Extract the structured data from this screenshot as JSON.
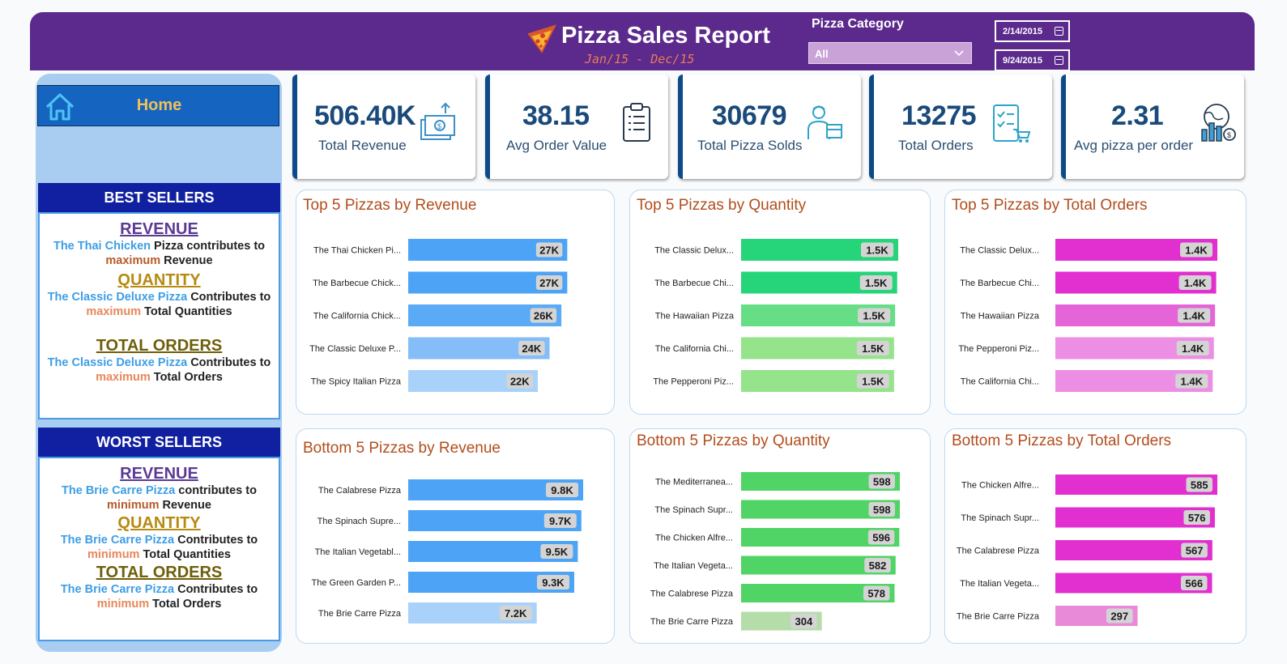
{
  "header": {
    "title": "Pizza Sales Report",
    "subtitle": "Jan/15 - Dec/15",
    "category_label": "Pizza Category",
    "category_value": "All",
    "start_date": "2/14/2015",
    "end_date": "9/24/2015",
    "color": "#5c2a8c"
  },
  "sidebar": {
    "home_label": "Home",
    "best": {
      "heading": "BEST SELLERS",
      "revenue_title": "REVENUE",
      "revenue_pizza": "The Thai Chicken",
      "revenue_mid": " Pizza contributes to",
      "revenue_word": "maximum",
      "revenue_tail": " Revenue",
      "quantity_title": "QUANTITY",
      "quantity_pizza": "The Classic Deluxe Pizza",
      "quantity_mid": " Contributes to ",
      "quantity_word": "maximum",
      "quantity_tail": " Total Quantities",
      "orders_title": "TOTAL ORDERS",
      "orders_pizza": "The Classic Deluxe Pizza",
      "orders_mid": " Contributes to ",
      "orders_word": "maximum",
      "orders_tail": " Total Orders"
    },
    "worst": {
      "heading": "WORST SELLERS",
      "revenue_title": "REVENUE",
      "revenue_pizza": "The Brie Carre Pizza",
      "revenue_mid": " contributes to",
      "revenue_word": "minimum",
      "revenue_tail": " Revenue",
      "quantity_title": "QUANTITY",
      "quantity_pizza": "The Brie Carre Pizza",
      "quantity_mid": " Contributes to ",
      "quantity_word": "minimum",
      "quantity_tail": " Total Quantities",
      "orders_title": "TOTAL ORDERS",
      "orders_pizza": "The Brie Carre Pizza",
      "orders_mid": " Contributes to ",
      "orders_word": "minimum",
      "orders_tail": " Total Orders"
    }
  },
  "kpis": [
    {
      "value": "506.40K",
      "label": "Total Revenue",
      "icon": "money-icon"
    },
    {
      "value": "38.15",
      "label": "Avg Order Value",
      "icon": "clipboard-icon"
    },
    {
      "value": "30679",
      "label": "Total Pizza Solds",
      "icon": "delivery-person-icon"
    },
    {
      "value": "13275",
      "label": "Total Orders",
      "icon": "order-checklist-icon"
    },
    {
      "value": "2.31",
      "label": "Avg pizza per order",
      "icon": "global-chart-icon"
    }
  ],
  "chart_data": [
    {
      "type": "bar",
      "title": "Top 5 Pizzas by Revenue",
      "categories": [
        "The Thai Chicken Pi...",
        "The Barbecue Chick...",
        "The California Chick...",
        "The Classic Deluxe P...",
        "The Spicy Italian Pizza"
      ],
      "values": [
        27000,
        27000,
        26000,
        24000,
        22000
      ],
      "labels": [
        "27K",
        "27K",
        "26K",
        "24K",
        "22K"
      ],
      "colors": [
        "#4da3f5",
        "#4da3f5",
        "#5baaf5",
        "#84bdf7",
        "#a8d2fa"
      ],
      "max": 27500
    },
    {
      "type": "bar",
      "title": "Top 5 Pizzas by Quantity",
      "categories": [
        "The Classic Delux...",
        "The Barbecue Chi...",
        "The Hawaiian Pizza",
        "The California Chi...",
        "The Pepperoni Piz..."
      ],
      "values": [
        1500,
        1490,
        1470,
        1460,
        1460
      ],
      "labels": [
        "1.5K",
        "1.5K",
        "1.5K",
        "1.5K",
        "1.5K"
      ],
      "colors": [
        "#26d47a",
        "#26d47a",
        "#66de86",
        "#95e38a",
        "#95e38a"
      ],
      "max": 1500
    },
    {
      "type": "bar",
      "title": "Top 5 Pizzas by Total Orders",
      "categories": [
        "The Classic Delux...",
        "The Barbecue Chi...",
        "The Hawaiian Pizza",
        "The Pepperoni Piz...",
        "The California Chi..."
      ],
      "values": [
        1400,
        1390,
        1380,
        1370,
        1360
      ],
      "labels": [
        "1.4K",
        "1.4K",
        "1.4K",
        "1.4K",
        "1.4K"
      ],
      "colors": [
        "#e22fcf",
        "#e22fcf",
        "#e565d9",
        "#ec8fe4",
        "#ec8fe4"
      ],
      "max": 1400
    },
    {
      "type": "bar",
      "title": "Bottom 5 Pizzas by Revenue",
      "categories": [
        "The Calabrese Pizza",
        "The Spinach Supre...",
        "The Italian Vegetabl...",
        "The Green Garden P...",
        "The Brie Carre Pizza"
      ],
      "values": [
        9800,
        9700,
        9500,
        9300,
        7200
      ],
      "labels": [
        "9.8K",
        "9.7K",
        "9.5K",
        "9.3K",
        "7.2K"
      ],
      "colors": [
        "#4da3f5",
        "#4da3f5",
        "#4da3f5",
        "#4da3f5",
        "#a8d2fa"
      ],
      "max": 9800
    },
    {
      "type": "bar",
      "title": "Bottom 5 Pizzas by Quantity",
      "categories": [
        "The Mediterranea...",
        "The Spinach Supr...",
        "The Chicken Alfre...",
        "The Italian Vegeta...",
        "The Calabrese Pizza",
        "The Brie Carre Pizza"
      ],
      "values": [
        598,
        598,
        596,
        582,
        578,
        304
      ],
      "labels": [
        "598",
        "598",
        "596",
        "582",
        "578",
        "304"
      ],
      "colors": [
        "#4fd465",
        "#4fd465",
        "#4fd465",
        "#4fd465",
        "#4fd465",
        "#b5ddaa"
      ],
      "max": 598
    },
    {
      "type": "bar",
      "title": "Bottom 5 Pizzas by Total Orders",
      "categories": [
        "The Chicken Alfre...",
        "The Spinach Supr...",
        "The Calabrese Pizza",
        "The Italian Vegeta...",
        "The Brie Carre Pizza"
      ],
      "values": [
        585,
        576,
        567,
        566,
        297
      ],
      "labels": [
        "585",
        "576",
        "567",
        "566",
        "297"
      ],
      "colors": [
        "#e22fcf",
        "#e22fcf",
        "#e22fcf",
        "#e22fcf",
        "#e88ad8"
      ],
      "max": 585
    }
  ]
}
